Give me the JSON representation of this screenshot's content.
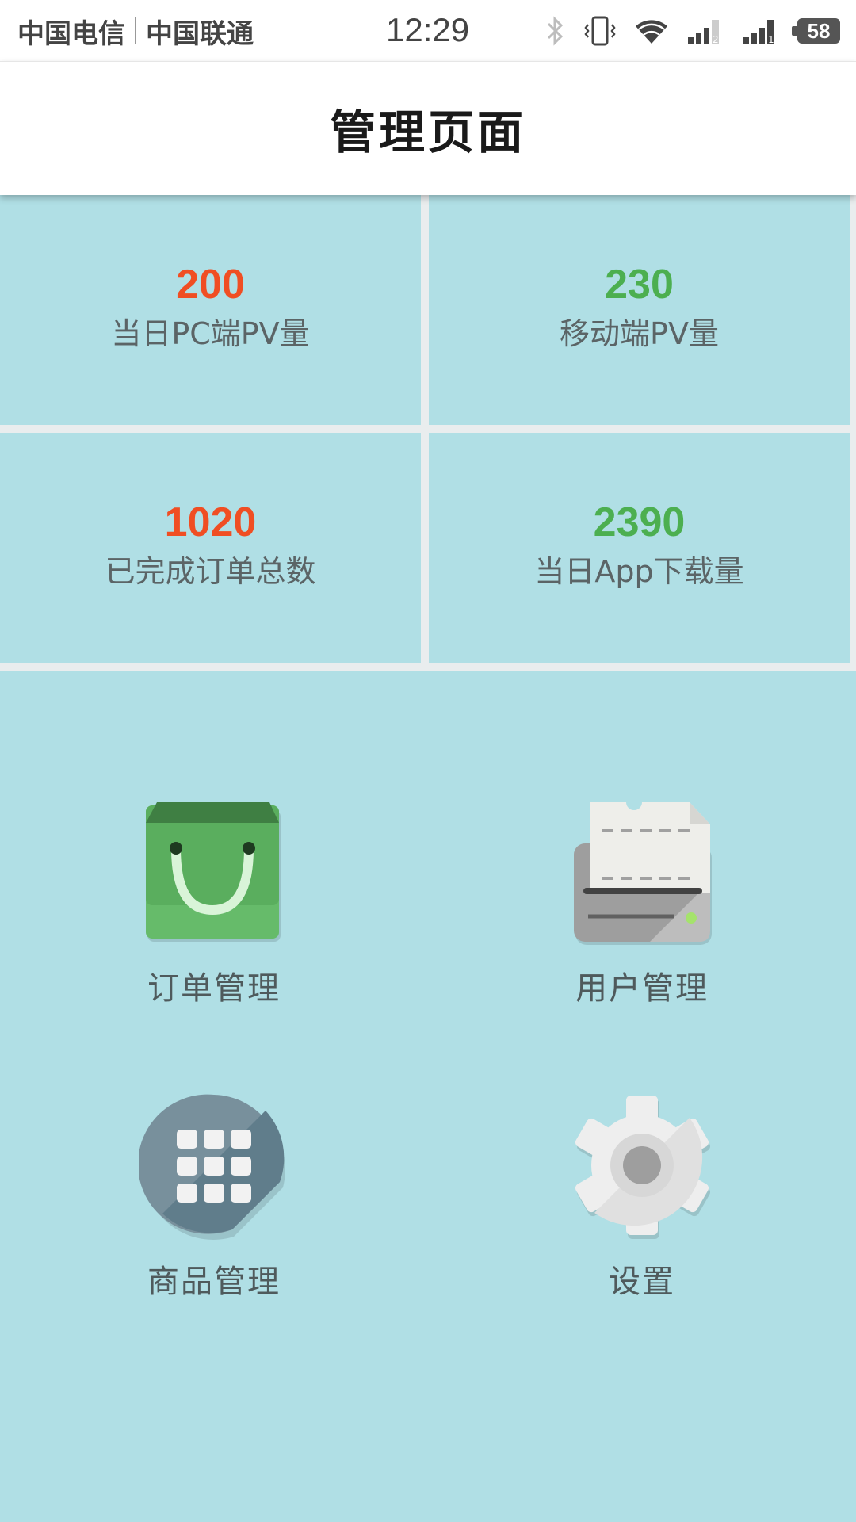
{
  "status_bar": {
    "carrier_1": "中国电信",
    "carrier_2": "中国联通",
    "time": "12:29",
    "battery": "58",
    "icons": [
      "bluetooth-icon",
      "vibrate-icon",
      "wifi-icon",
      "signal-sim2-icon",
      "signal-sim1-icon",
      "battery-icon"
    ]
  },
  "header": {
    "title": "管理页面"
  },
  "stats": [
    {
      "value": "200",
      "label": "当日PC端PV量",
      "color": "#f04e23"
    },
    {
      "value": "230",
      "label": "移动端PV量",
      "color": "#4caf50"
    },
    {
      "value": "1020",
      "label": "已完成订单总数",
      "color": "#f04e23"
    },
    {
      "value": "2390",
      "label": "当日App下载量",
      "color": "#4caf50"
    }
  ],
  "menu": [
    {
      "label": "订单管理",
      "icon": "shopping-bag-icon"
    },
    {
      "label": "用户管理",
      "icon": "printer-icon"
    },
    {
      "label": "商品管理",
      "icon": "app-grid-icon"
    },
    {
      "label": "设置",
      "icon": "gear-icon"
    }
  ],
  "colors": {
    "background": "#b0dfe5",
    "divider": "#e9edee",
    "accent_red": "#f04e23",
    "accent_green": "#4caf50"
  }
}
